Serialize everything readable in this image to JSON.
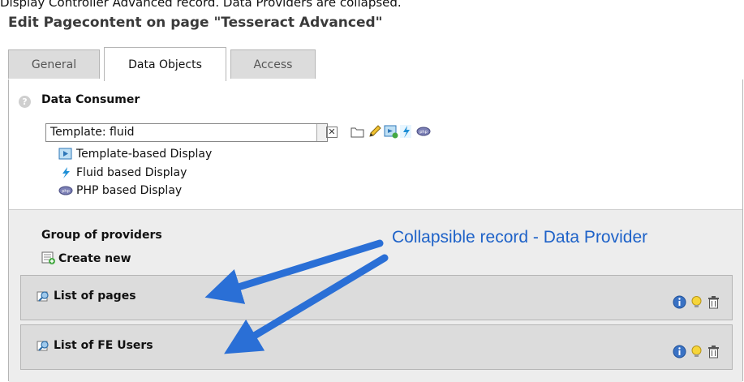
{
  "caption": "Display Controller Advanced record. Data Providers are collapsed.",
  "page_title": "Edit Pagecontent on page \"Tesseract Advanced\"",
  "tabs": [
    {
      "label": "General"
    },
    {
      "label": "Data Objects"
    },
    {
      "label": "Access"
    }
  ],
  "consumer": {
    "label": "Data Consumer",
    "selected_value": "Template: fluid",
    "clear_glyph": "✕",
    "options": [
      {
        "label": "Template-based Display",
        "icon": "template-display-icon"
      },
      {
        "label": "Fluid based Display",
        "icon": "fluid-icon"
      },
      {
        "label": "PHP based Display",
        "icon": "php-icon"
      }
    ]
  },
  "providers": {
    "label": "Group of providers",
    "create_new": "Create new",
    "records": [
      {
        "title": "List of pages"
      },
      {
        "title": "List of FE Users"
      }
    ]
  },
  "annotation": "Collapsible record - Data Provider",
  "colors": {
    "annotation": "#1e62c8",
    "tab_inactive": "#dcdcdc",
    "providers_bg": "#ededed"
  }
}
